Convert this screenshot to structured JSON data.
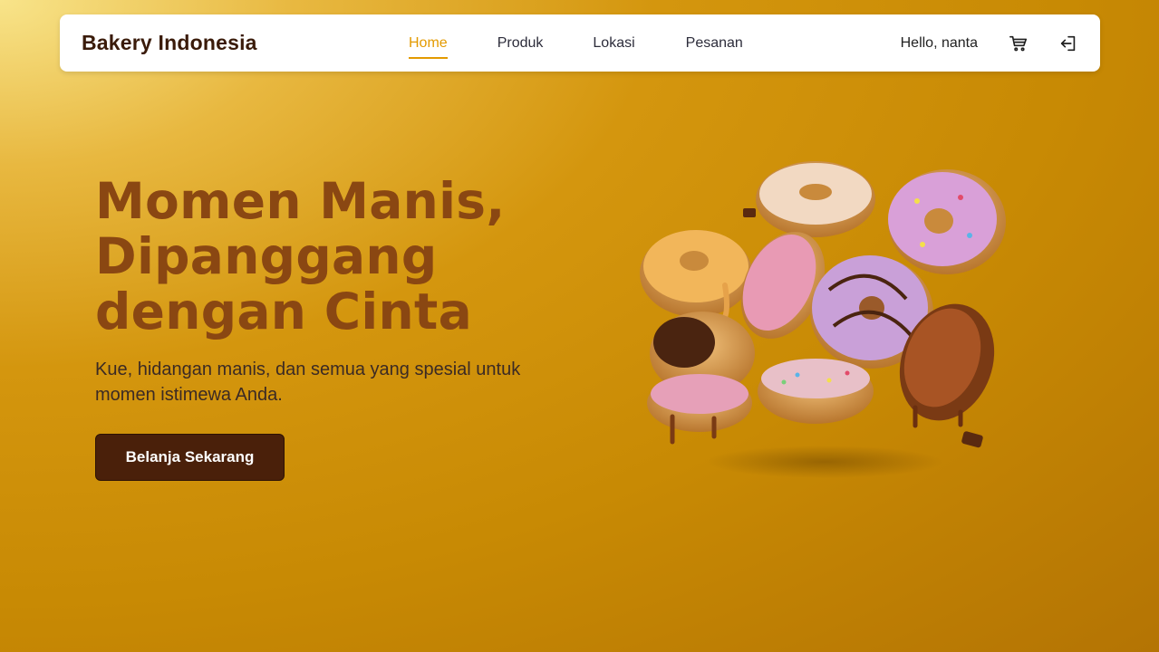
{
  "navbar": {
    "brand": "Bakery Indonesia",
    "links": [
      {
        "label": "Home",
        "active": true
      },
      {
        "label": "Produk",
        "active": false
      },
      {
        "label": "Lokasi",
        "active": false
      },
      {
        "label": "Pesanan",
        "active": false
      }
    ],
    "greeting": "Hello, nanta",
    "cart_icon": "shopping-cart-icon",
    "logout_icon": "logout-icon"
  },
  "hero": {
    "title_lines": [
      "Momen Manis,",
      "Dipanggang",
      "dengan Cinta"
    ],
    "subtitle": "Kue, hidangan manis, dan semua yang spesial untuk momen istimewa Anda.",
    "cta_label": "Belanja Sekarang",
    "image": "donuts-illustration"
  },
  "colors": {
    "accent": "#e39a00",
    "title": "#8a4712",
    "button": "#4a200a"
  }
}
